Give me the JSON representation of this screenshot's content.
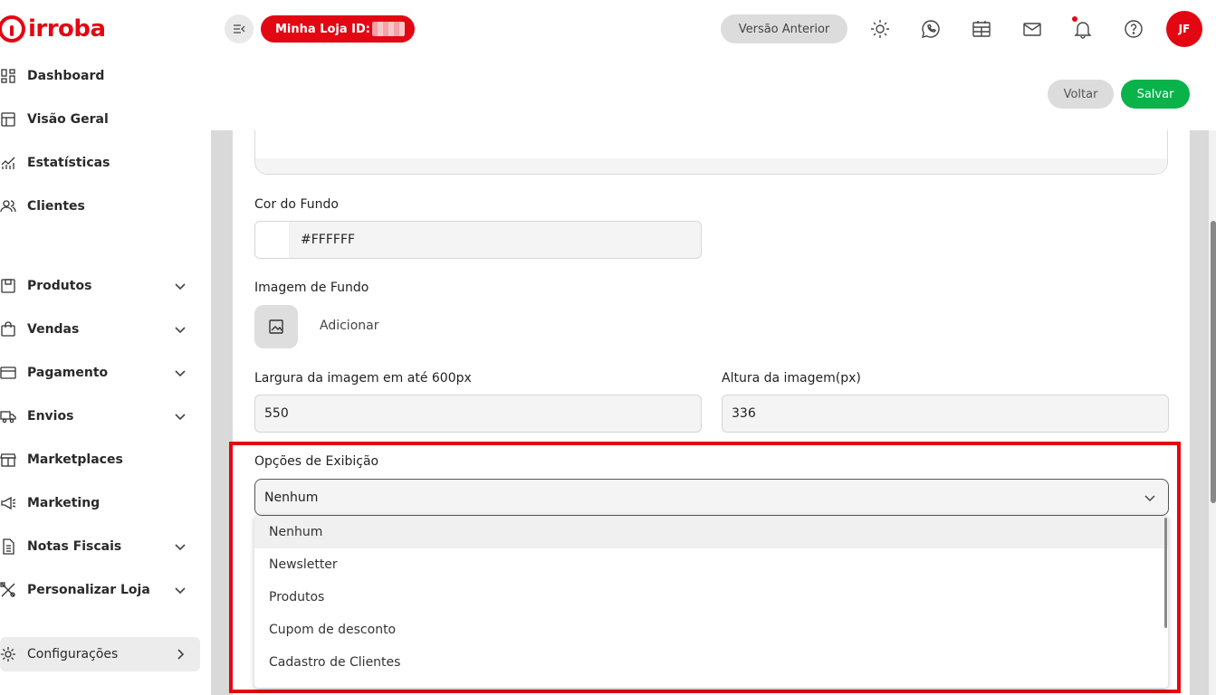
{
  "brand": {
    "name": "irroba",
    "color": "#e30613"
  },
  "sidebar": {
    "items": [
      {
        "label": "Dashboard",
        "icon": "dashboard-icon",
        "expandable": false
      },
      {
        "label": "Visão Geral",
        "icon": "layout-icon",
        "expandable": false
      },
      {
        "label": "Estatísticas",
        "icon": "chart-icon",
        "expandable": false
      },
      {
        "label": "Clientes",
        "icon": "users-icon",
        "expandable": false
      },
      {
        "label": "Produtos",
        "icon": "box-icon",
        "expandable": true
      },
      {
        "label": "Vendas",
        "icon": "bag-icon",
        "expandable": true
      },
      {
        "label": "Pagamento",
        "icon": "card-icon",
        "expandable": true
      },
      {
        "label": "Envios",
        "icon": "truck-icon",
        "expandable": true
      },
      {
        "label": "Marketplaces",
        "icon": "store-icon",
        "expandable": false
      },
      {
        "label": "Marketing",
        "icon": "megaphone-icon",
        "expandable": false
      },
      {
        "label": "Notas Fiscais",
        "icon": "document-icon",
        "expandable": true
      },
      {
        "label": "Personalizar Loja",
        "icon": "tools-icon",
        "expandable": true
      },
      {
        "label": "Configurações",
        "icon": "gear-icon",
        "expandable": true,
        "active": true
      }
    ]
  },
  "header": {
    "store_label": "Minha Loja ID:",
    "version_button": "Versão Anterior",
    "icons": [
      "sun-icon",
      "whatsapp-icon",
      "calendar-icon",
      "mail-icon",
      "bell-icon",
      "help-icon"
    ],
    "avatar_initials": "JF"
  },
  "actions": {
    "back": "Voltar",
    "save": "Salvar"
  },
  "form": {
    "bg_color_label": "Cor do Fundo",
    "bg_color_value": "#FFFFFF",
    "bg_image_label": "Imagem de Fundo",
    "bg_image_add": "Adicionar",
    "width_label": "Largura da imagem em até 600px",
    "width_value": "550",
    "height_label": "Altura da imagem(px)",
    "height_value": "336",
    "display_label": "Opções de Exibição",
    "display_value": "Nenhum",
    "display_options": [
      "Nenhum",
      "Newsletter",
      "Produtos",
      "Cupom de desconto",
      "Cadastro de Clientes"
    ]
  },
  "colors": {
    "accent": "#e30613",
    "success": "#0ab24a",
    "highlight": "#e30613"
  }
}
